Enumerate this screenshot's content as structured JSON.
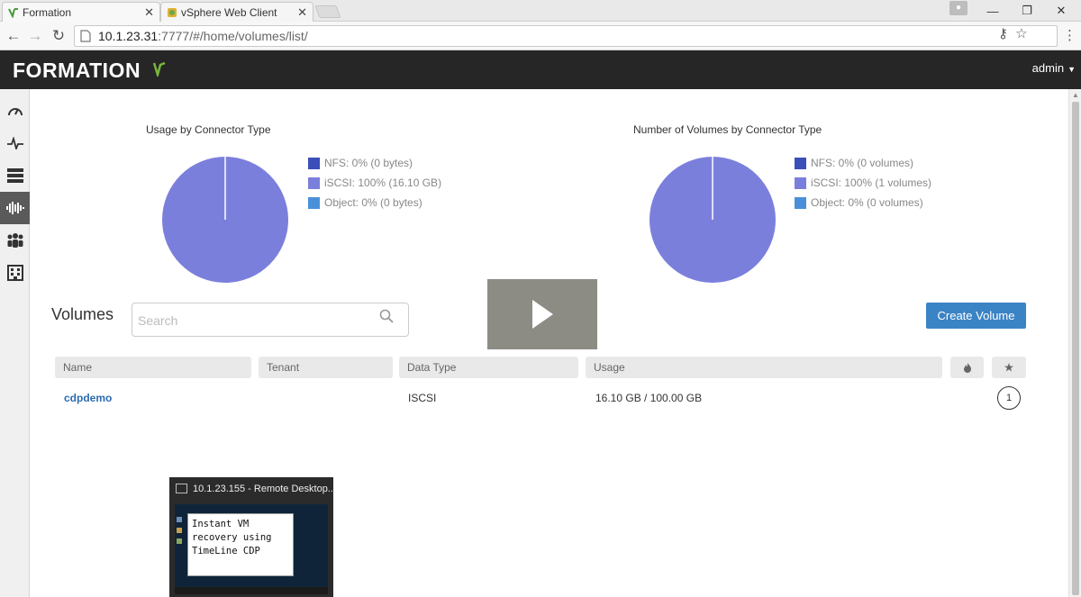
{
  "browser": {
    "tabs": [
      {
        "label": "Formation",
        "active": true
      },
      {
        "label": "vSphere Web Client",
        "active": false
      }
    ],
    "url_host": "10.1.23.31",
    "url_path": ":7777/#/home/volumes/list/"
  },
  "app": {
    "logo": "FORMATION",
    "user": "admin"
  },
  "charts": {
    "chart_data": [
      {
        "type": "pie",
        "title": "Usage by Connector Type",
        "categories": [
          "NFS",
          "iSCSI",
          "Object"
        ],
        "values": [
          0,
          100,
          0
        ],
        "legend": [
          "NFS: 0% (0 bytes)",
          "iSCSI: 100% (16.10 GB)",
          "Object: 0% (0 bytes)"
        ],
        "colors": [
          "#3a4fb8",
          "#7b7fdc",
          "#4a90d9"
        ],
        "legend_placement": "right"
      },
      {
        "type": "pie",
        "title": "Number of Volumes by Connector Type",
        "categories": [
          "NFS",
          "iSCSI",
          "Object"
        ],
        "values": [
          0,
          1,
          0
        ],
        "legend": [
          "NFS: 0% (0 volumes)",
          "iSCSI: 100% (1 volumes)",
          "Object: 0% (0 volumes)"
        ],
        "colors": [
          "#3a4fb8",
          "#7b7fdc",
          "#4a90d9"
        ],
        "legend_placement": "right"
      }
    ]
  },
  "volumes": {
    "title": "Volumes",
    "search_placeholder": "Search",
    "create_button": "Create Volume",
    "columns": [
      "Name",
      "Tenant",
      "Data Type",
      "Usage"
    ],
    "rows": [
      {
        "name": "cdpdemo",
        "tenant": "",
        "data_type": "ISCSI",
        "usage": "16.10 GB / 100.00 GB",
        "priority": "1"
      }
    ]
  },
  "rdp": {
    "title": "10.1.23.155 - Remote Desktop...",
    "text": "Instant VM\nrecovery using\nTimeLine CDP"
  },
  "colors": {
    "accent": "#3a83c5",
    "header_bg": "#262626",
    "link": "#2d6cb0"
  }
}
